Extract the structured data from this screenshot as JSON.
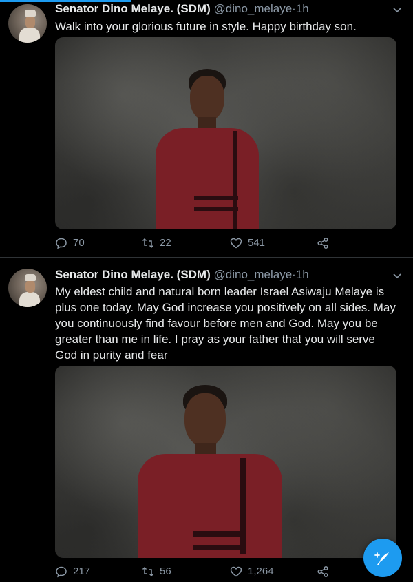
{
  "tweets": [
    {
      "author_name": "Senator Dino Melaye. (SDM)",
      "handle": "@dino_melaye",
      "separator": "·",
      "time": "1h",
      "text": "Walk into your glorious future in style. Happy birthday son.",
      "stats": {
        "replies": "70",
        "retweets": "22",
        "likes": "541"
      }
    },
    {
      "author_name": "Senator Dino Melaye. (SDM)",
      "handle": "@dino_melaye",
      "separator": "·",
      "time": "1h",
      "text": "My eldest child and natural born leader Israel Asiwaju Melaye is plus one today. May God increase you positively on all sides. May you continuously find favour before men and God. May you be greater than me in life. I pray as your father that you will serve God in purity and fear",
      "stats": {
        "replies": "217",
        "retweets": "56",
        "likes": "1,264"
      }
    }
  ],
  "icons": {
    "reply": "reply-icon",
    "retweet": "retweet-icon",
    "like": "like-icon",
    "share": "share-icon",
    "menu": "chevron-down-icon",
    "compose": "compose-icon"
  },
  "colors": {
    "accent": "#1d9bf0",
    "background": "#000000",
    "muted": "#8b98a5"
  }
}
